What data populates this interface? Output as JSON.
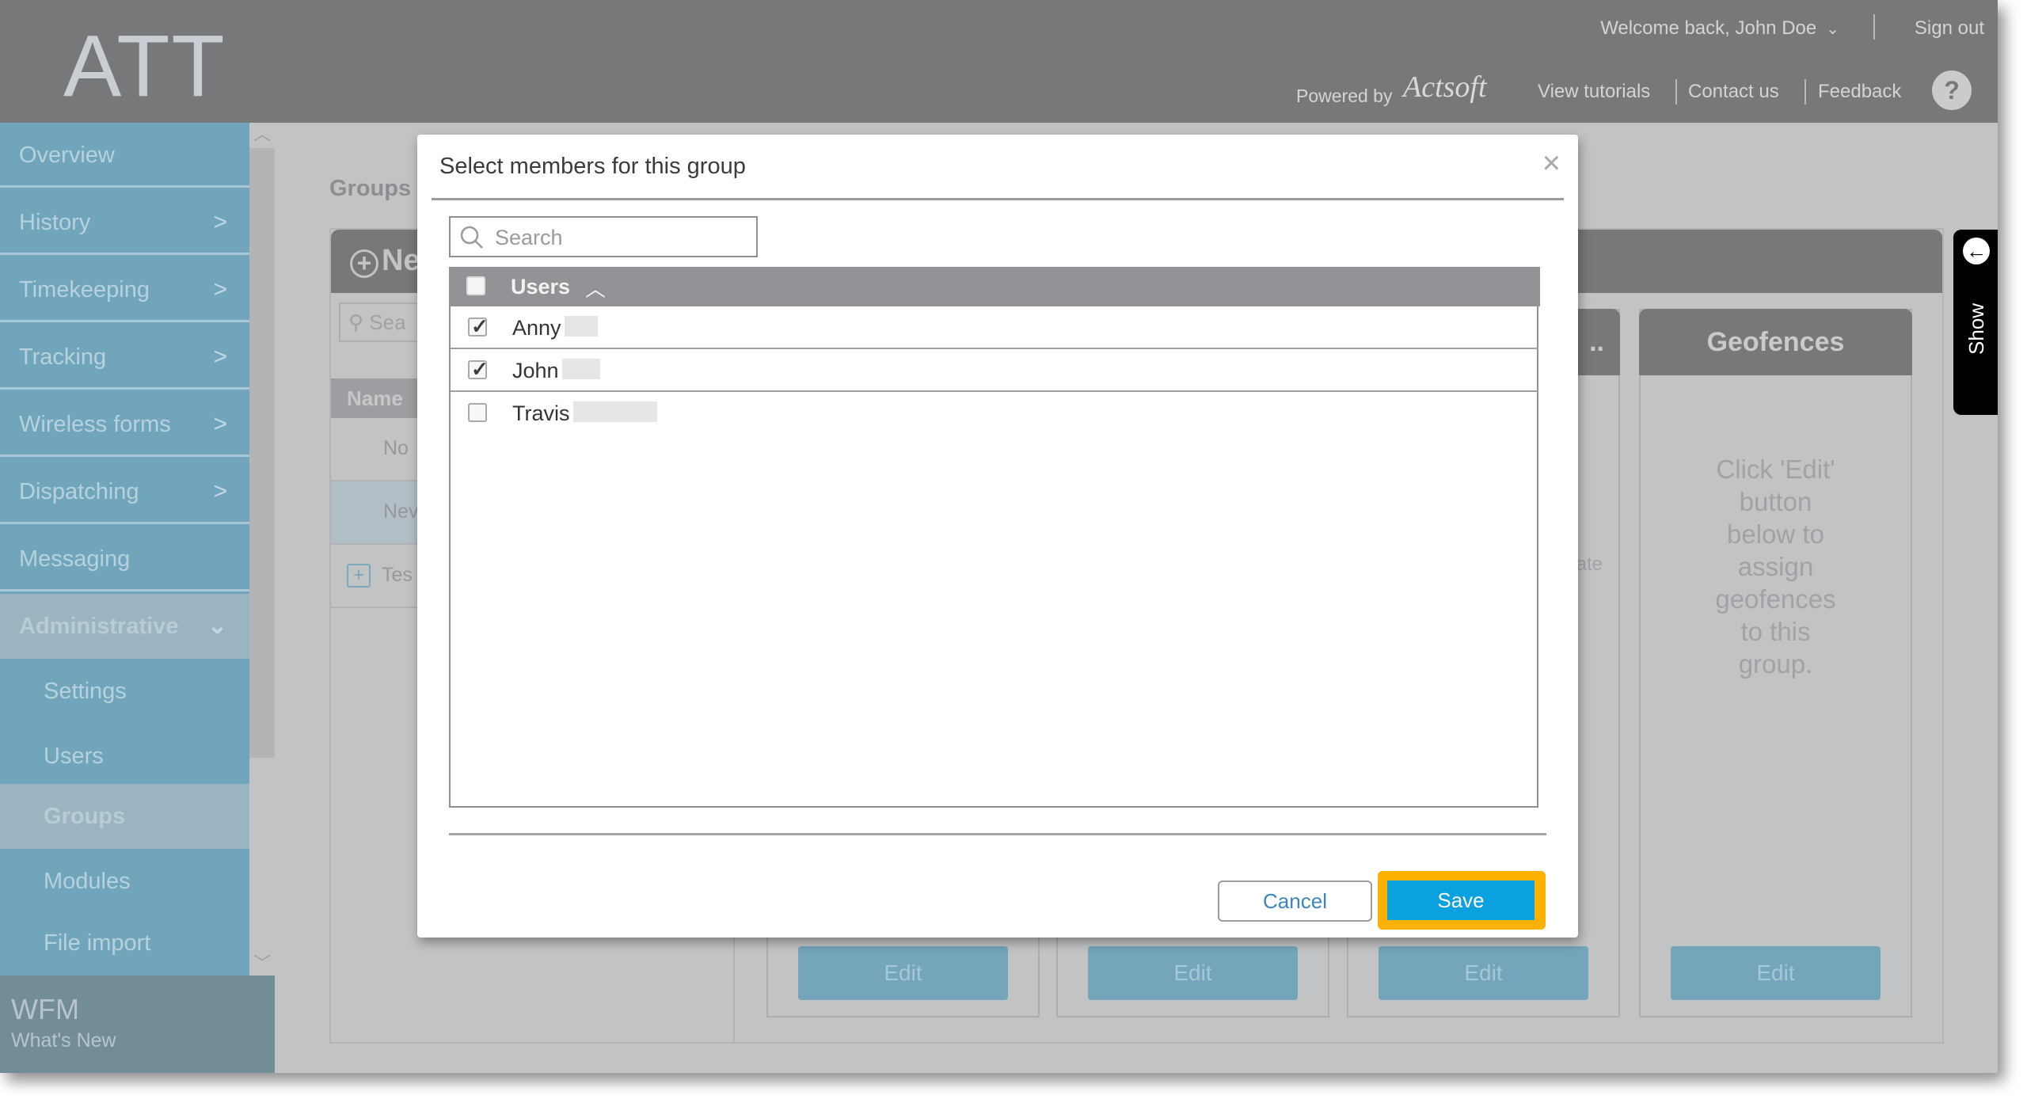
{
  "header": {
    "logo": "ATT",
    "welcome": "Welcome back, John Doe",
    "sign_out": "Sign out",
    "powered_by": "Powered by",
    "brand": "Actsoft",
    "links": [
      "View tutorials",
      "Contact us",
      "Feedback"
    ],
    "help": "?"
  },
  "sidebar": {
    "items": [
      {
        "label": "Overview",
        "has_arrow": false
      },
      {
        "label": "History",
        "has_arrow": true
      },
      {
        "label": "Timekeeping",
        "has_arrow": true
      },
      {
        "label": "Tracking",
        "has_arrow": true
      },
      {
        "label": "Wireless forms",
        "has_arrow": true
      },
      {
        "label": "Dispatching",
        "has_arrow": true
      },
      {
        "label": "Messaging",
        "has_arrow": false
      }
    ],
    "section": {
      "label": "Administrative",
      "expanded": true
    },
    "sub_items": [
      {
        "label": "Settings",
        "active": false
      },
      {
        "label": "Users",
        "active": false
      },
      {
        "label": "Groups",
        "active": true
      },
      {
        "label": "Modules",
        "active": false
      },
      {
        "label": "File import",
        "active": false
      }
    ],
    "footer": {
      "title": "WFM",
      "subtitle": "What's New"
    }
  },
  "background": {
    "page_title": "Groups",
    "new_button": "Ne",
    "search_placeholder": "Sea",
    "name_header": "Name",
    "rows": [
      "No",
      "Nev",
      "Tes"
    ],
    "card_truncated_title": "..",
    "card_fragment": "ate",
    "geofences": {
      "title": "Geofences",
      "body": "Click 'Edit' button below to assign geofences to this group."
    },
    "edit_label": "Edit",
    "show_tab": "Show"
  },
  "modal": {
    "title": "Select members for this group",
    "close": "×",
    "search_placeholder": "Search",
    "search_value": "",
    "column_header": "Users",
    "sort": "ascending",
    "select_all_checked": false,
    "users": [
      {
        "name": "Anny",
        "checked": true
      },
      {
        "name": "John",
        "checked": true
      },
      {
        "name": "Travis",
        "checked": false
      }
    ],
    "cancel_label": "Cancel",
    "save_label": "Save",
    "highlight_color": "#fdb100",
    "save_color": "#0ba0de"
  }
}
